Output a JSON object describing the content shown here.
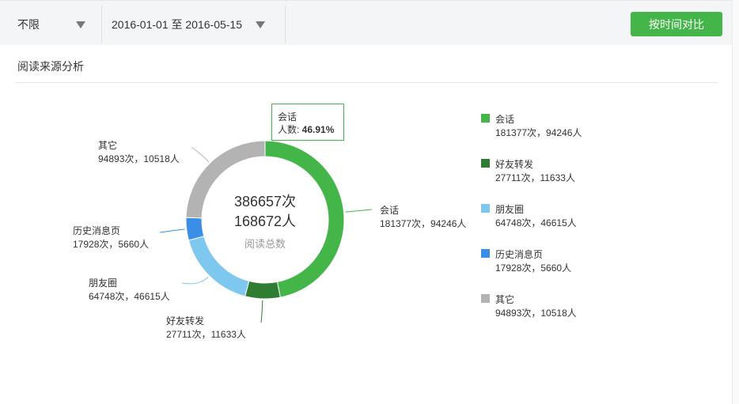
{
  "filters": {
    "source_filter": "不限",
    "date_range": "2016-01-01 至 2016-05-15",
    "compare_button": "按时间对比"
  },
  "section": {
    "title": "阅读来源分析"
  },
  "chart_center": {
    "total_reads": "386657次",
    "total_users": "168672人",
    "caption": "阅读总数"
  },
  "tooltip": {
    "name": "会话",
    "label": "人数: ",
    "value": "46.91%"
  },
  "chart_data": {
    "type": "pie",
    "donut": true,
    "slices": [
      {
        "name": "会话",
        "reads": 181377,
        "users": 94246,
        "stat": "181377次，94246人",
        "color": "#44b549"
      },
      {
        "name": "好友转发",
        "reads": 27711,
        "users": 11633,
        "stat": "27711次，11633人",
        "color": "#2e7d32"
      },
      {
        "name": "朋友圈",
        "reads": 64748,
        "users": 46615,
        "stat": "64748次，46615人",
        "color": "#7ec8f0"
      },
      {
        "name": "历史消息页",
        "reads": 17928,
        "users": 5660,
        "stat": "17928次，5660人",
        "color": "#3a8ee6"
      },
      {
        "name": "其它",
        "reads": 94893,
        "users": 10518,
        "stat": "94893次，10518人",
        "color": "#b3b3b3"
      }
    ]
  }
}
